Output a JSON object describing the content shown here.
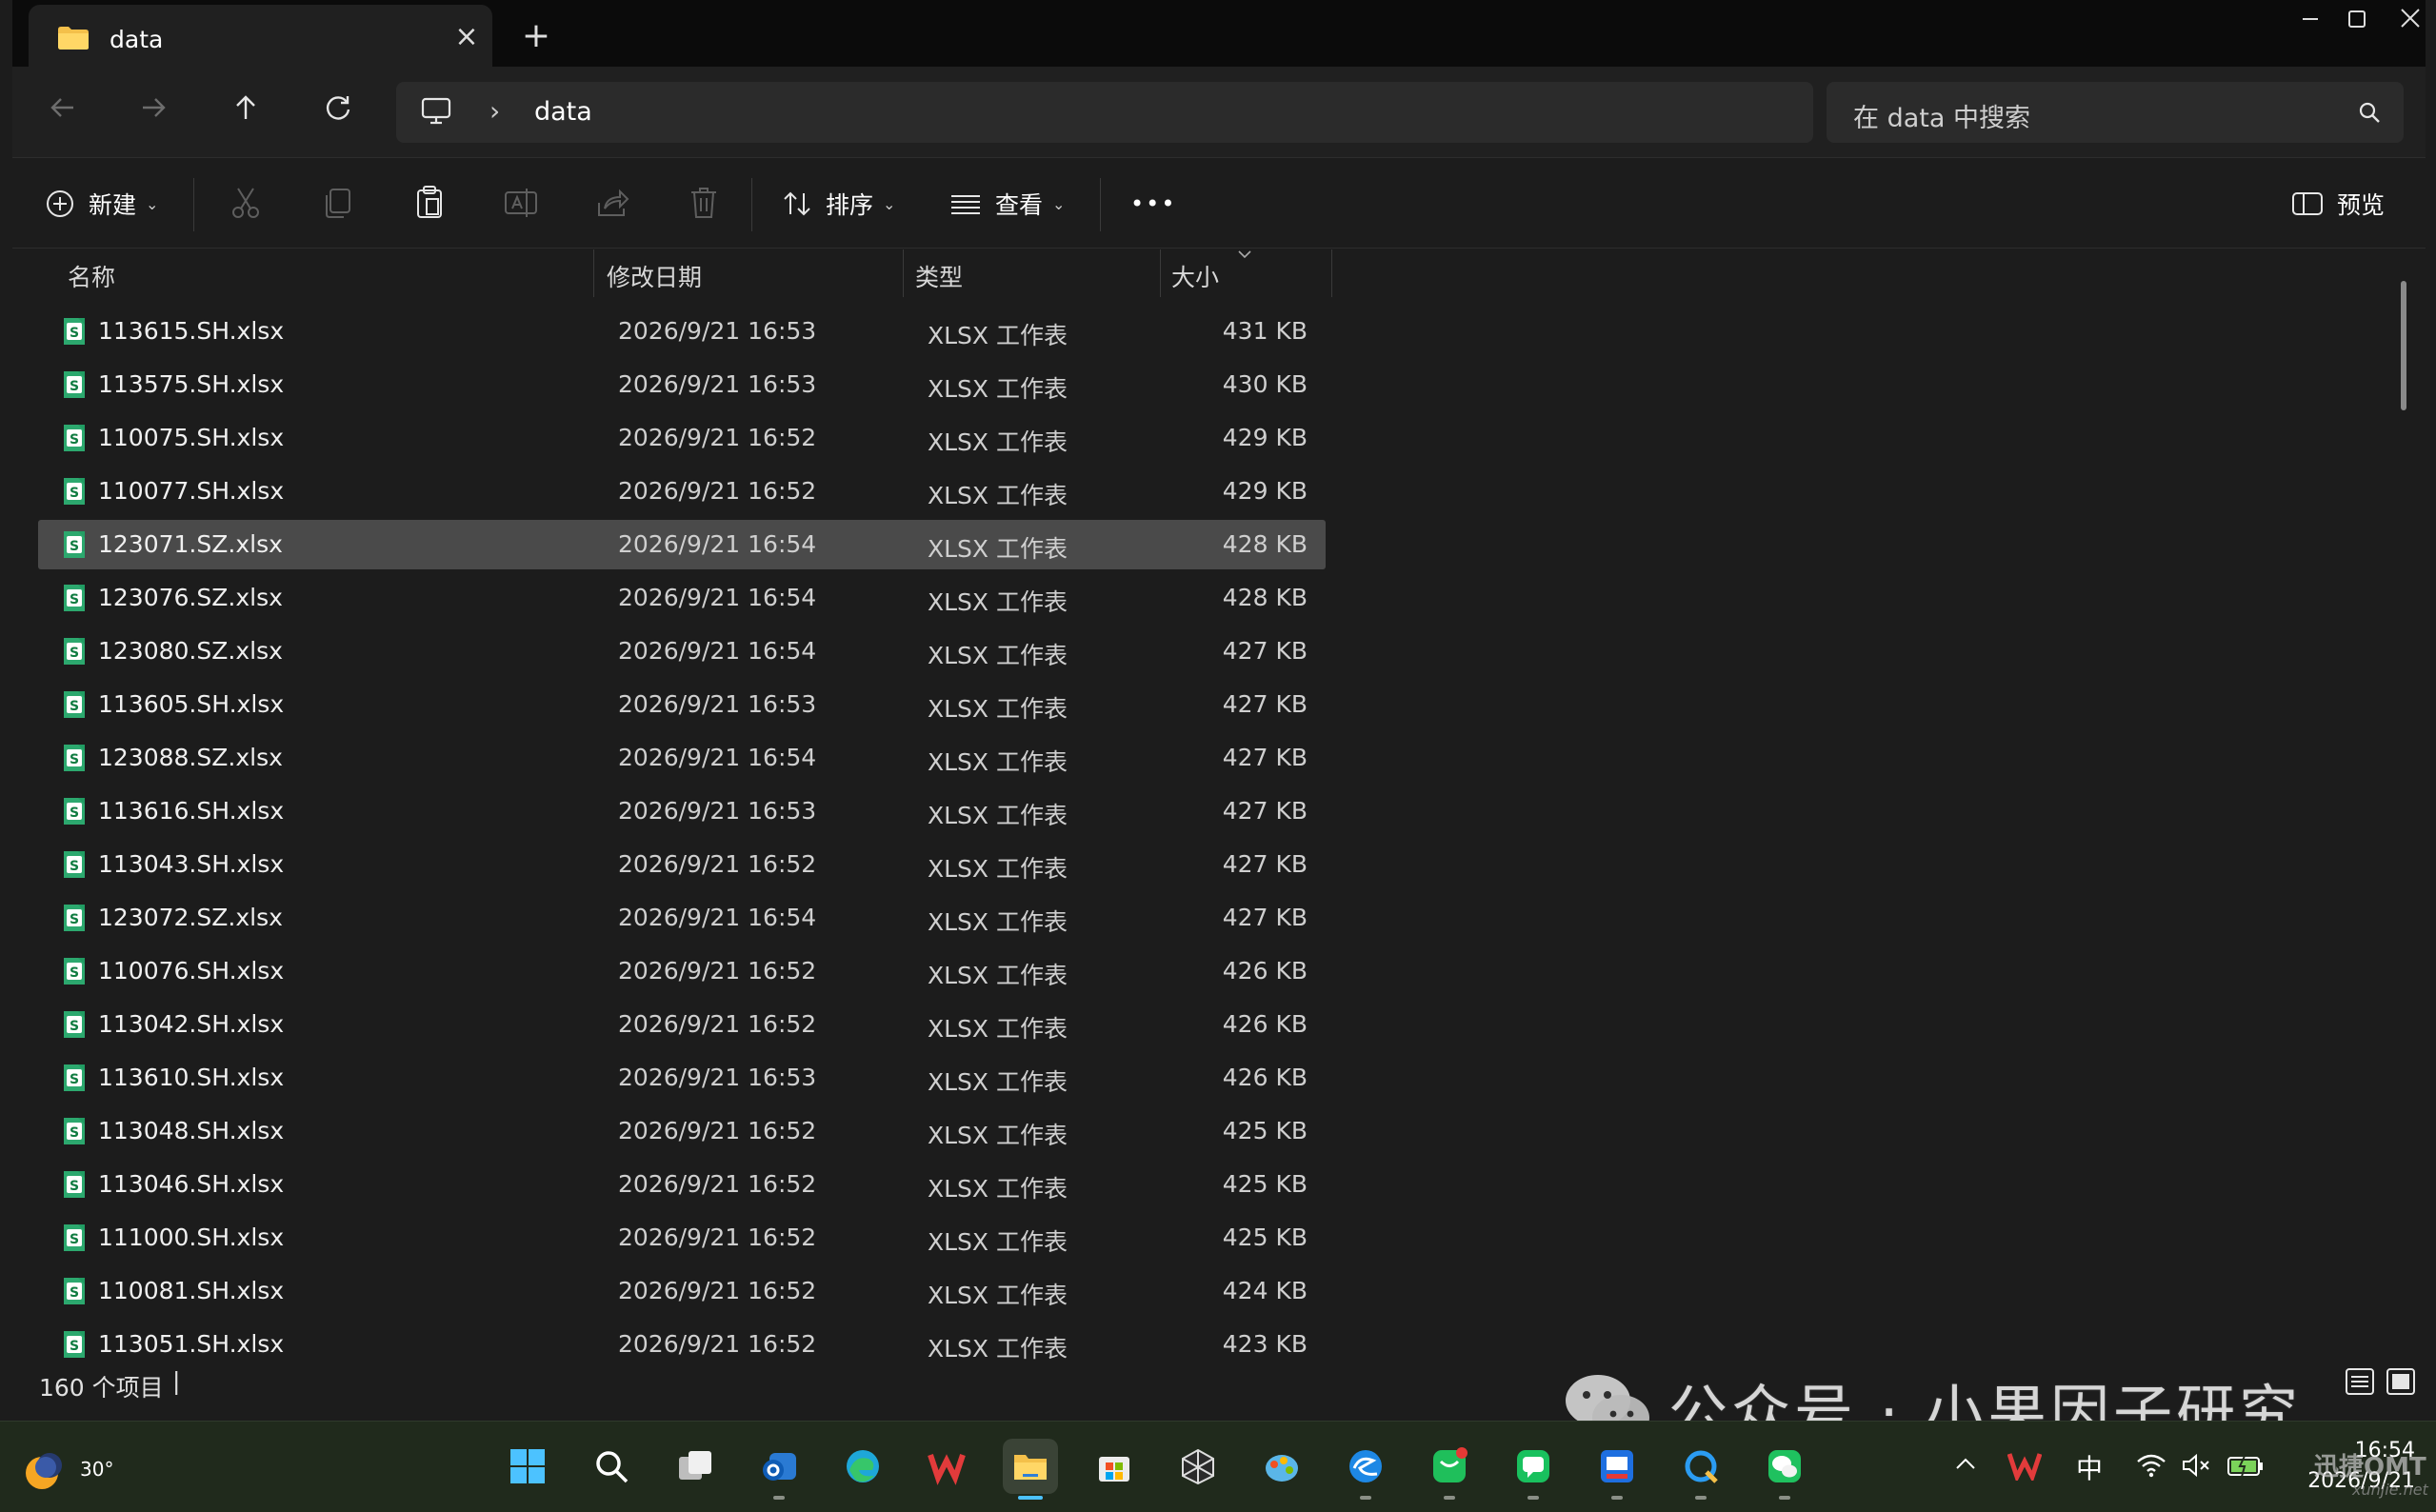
{
  "window": {
    "tab_title": "data",
    "controls": {
      "minimize": "—",
      "maximize": "☐",
      "close": "✕"
    }
  },
  "nav": {
    "back_icon": "arrow-left-icon",
    "forward_icon": "arrow-right-icon",
    "up_icon": "arrow-up-icon",
    "refresh_icon": "refresh-icon",
    "breadcrumb_sep": "›",
    "breadcrumb": "data",
    "search_placeholder": "在 data 中搜索"
  },
  "commandbar": {
    "new_label": "新建",
    "sort_label": "排序",
    "view_label": "查看",
    "more_label": "•••",
    "preview_label": "预览"
  },
  "columns": {
    "name": "名称",
    "date": "修改日期",
    "type": "类型",
    "size": "大小"
  },
  "files": [
    {
      "name": "113615.SH.xlsx",
      "date": "2026/9/21 16:53",
      "type": "XLSX 工作表",
      "size": "431 KB"
    },
    {
      "name": "113575.SH.xlsx",
      "date": "2026/9/21 16:53",
      "type": "XLSX 工作表",
      "size": "430 KB"
    },
    {
      "name": "110075.SH.xlsx",
      "date": "2026/9/21 16:52",
      "type": "XLSX 工作表",
      "size": "429 KB"
    },
    {
      "name": "110077.SH.xlsx",
      "date": "2026/9/21 16:52",
      "type": "XLSX 工作表",
      "size": "429 KB"
    },
    {
      "name": "123071.SZ.xlsx",
      "date": "2026/9/21 16:54",
      "type": "XLSX 工作表",
      "size": "428 KB",
      "selected": true
    },
    {
      "name": "123076.SZ.xlsx",
      "date": "2026/9/21 16:54",
      "type": "XLSX 工作表",
      "size": "428 KB"
    },
    {
      "name": "123080.SZ.xlsx",
      "date": "2026/9/21 16:54",
      "type": "XLSX 工作表",
      "size": "427 KB"
    },
    {
      "name": "113605.SH.xlsx",
      "date": "2026/9/21 16:53",
      "type": "XLSX 工作表",
      "size": "427 KB"
    },
    {
      "name": "123088.SZ.xlsx",
      "date": "2026/9/21 16:54",
      "type": "XLSX 工作表",
      "size": "427 KB"
    },
    {
      "name": "113616.SH.xlsx",
      "date": "2026/9/21 16:53",
      "type": "XLSX 工作表",
      "size": "427 KB"
    },
    {
      "name": "113043.SH.xlsx",
      "date": "2026/9/21 16:52",
      "type": "XLSX 工作表",
      "size": "427 KB"
    },
    {
      "name": "123072.SZ.xlsx",
      "date": "2026/9/21 16:54",
      "type": "XLSX 工作表",
      "size": "427 KB"
    },
    {
      "name": "110076.SH.xlsx",
      "date": "2026/9/21 16:52",
      "type": "XLSX 工作表",
      "size": "426 KB"
    },
    {
      "name": "113042.SH.xlsx",
      "date": "2026/9/21 16:52",
      "type": "XLSX 工作表",
      "size": "426 KB"
    },
    {
      "name": "113610.SH.xlsx",
      "date": "2026/9/21 16:53",
      "type": "XLSX 工作表",
      "size": "426 KB"
    },
    {
      "name": "113048.SH.xlsx",
      "date": "2026/9/21 16:52",
      "type": "XLSX 工作表",
      "size": "425 KB"
    },
    {
      "name": "113046.SH.xlsx",
      "date": "2026/9/21 16:52",
      "type": "XLSX 工作表",
      "size": "425 KB"
    },
    {
      "name": "111000.SH.xlsx",
      "date": "2026/9/21 16:52",
      "type": "XLSX 工作表",
      "size": "425 KB"
    },
    {
      "name": "110081.SH.xlsx",
      "date": "2026/9/21 16:52",
      "type": "XLSX 工作表",
      "size": "424 KB"
    },
    {
      "name": "113051.SH.xlsx",
      "date": "2026/9/21 16:52",
      "type": "XLSX 工作表",
      "size": "423 KB"
    }
  ],
  "status": {
    "count": "160 个项目",
    "cursor": "|"
  },
  "taskbar": {
    "weather_temp": "30°",
    "apps": [
      "windows-start",
      "search",
      "task-view",
      "outlook",
      "edge",
      "wps",
      "file-explorer",
      "microsoft-store",
      "unity",
      "paint",
      "edge-ai",
      "messenger",
      "wechat-work",
      "tencent-meeting",
      "qq-browser",
      "wechat"
    ],
    "tray": {
      "ime": "中",
      "time": "16:54",
      "date": "2026/9/21"
    }
  },
  "watermark": {
    "text": "公众号 · 小果因子研究",
    "brand": "迅捷OMT",
    "site": "xunjie.net"
  },
  "colors": {
    "excel_green": "#21a366",
    "accent": "#4cc2ff"
  }
}
